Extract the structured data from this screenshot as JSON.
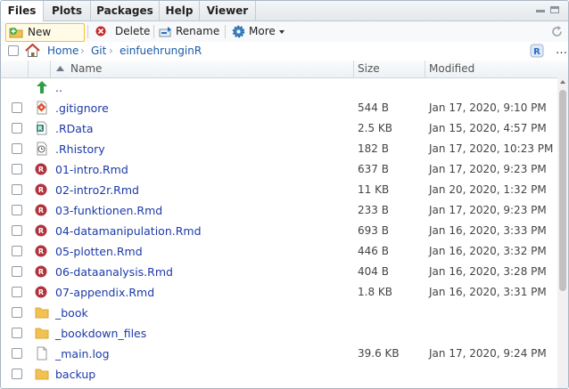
{
  "tabs": [
    "Files",
    "Plots",
    "Packages",
    "Help",
    "Viewer"
  ],
  "toolbar": {
    "new_folder": "New Folder",
    "delete": "Delete",
    "rename": "Rename",
    "more": "More"
  },
  "breadcrumb": [
    "Home",
    "Git",
    "einfuehrunginR"
  ],
  "columns": {
    "name": "Name",
    "size": "Size",
    "modified": "Modified"
  },
  "files": [
    {
      "name": "..",
      "size": "",
      "modified": "",
      "icon": "parent-arrow-icon",
      "checkbox": false
    },
    {
      "name": ".gitignore",
      "size": "544 B",
      "modified": "Jan 17, 2020, 9:10 PM",
      "icon": "git-file-icon",
      "checkbox": true
    },
    {
      "name": ".RData",
      "size": "2.5 KB",
      "modified": "Jan 15, 2020, 4:57 PM",
      "icon": "rdata-file-icon",
      "checkbox": true
    },
    {
      "name": ".Rhistory",
      "size": "182 B",
      "modified": "Jan 17, 2020, 10:23 PM",
      "icon": "history-file-icon",
      "checkbox": true
    },
    {
      "name": "01-intro.Rmd",
      "size": "637 B",
      "modified": "Jan 17, 2020, 9:23 PM",
      "icon": "rmd-file-icon",
      "checkbox": true
    },
    {
      "name": "02-intro2r.Rmd",
      "size": "11 KB",
      "modified": "Jan 20, 2020, 1:32 PM",
      "icon": "rmd-file-icon",
      "checkbox": true
    },
    {
      "name": "03-funktionen.Rmd",
      "size": "233 B",
      "modified": "Jan 17, 2020, 9:23 PM",
      "icon": "rmd-file-icon",
      "checkbox": true
    },
    {
      "name": "04-datamanipulation.Rmd",
      "size": "693 B",
      "modified": "Jan 16, 2020, 3:33 PM",
      "icon": "rmd-file-icon",
      "checkbox": true
    },
    {
      "name": "05-plotten.Rmd",
      "size": "446 B",
      "modified": "Jan 16, 2020, 3:32 PM",
      "icon": "rmd-file-icon",
      "checkbox": true
    },
    {
      "name": "06-dataanalysis.Rmd",
      "size": "404 B",
      "modified": "Jan 16, 2020, 3:28 PM",
      "icon": "rmd-file-icon",
      "checkbox": true
    },
    {
      "name": "07-appendix.Rmd",
      "size": "1.8 KB",
      "modified": "Jan 16, 2020, 3:31 PM",
      "icon": "rmd-file-icon",
      "checkbox": true
    },
    {
      "name": "_book",
      "size": "",
      "modified": "",
      "icon": "folder-icon",
      "checkbox": true
    },
    {
      "name": "_bookdown_files",
      "size": "",
      "modified": "",
      "icon": "folder-icon",
      "checkbox": true
    },
    {
      "name": "_main.log",
      "size": "39.6 KB",
      "modified": "Jan 17, 2020, 9:24 PM",
      "icon": "text-file-icon",
      "checkbox": true
    },
    {
      "name": "backup",
      "size": "",
      "modified": "",
      "icon": "folder-icon",
      "checkbox": true
    }
  ],
  "colors": {
    "link": "#1c3aa9",
    "breadcrumb_link": "#1c5aa6",
    "folder": "#f1c24f",
    "rmd": "#b0333e"
  }
}
